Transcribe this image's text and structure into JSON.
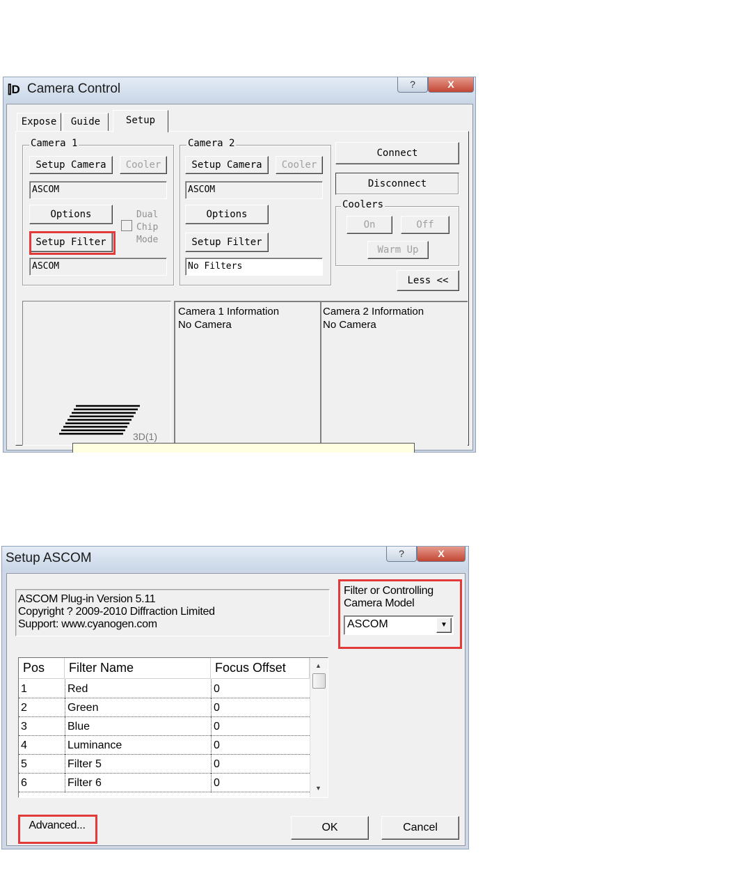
{
  "camera_control": {
    "title": "Camera Control",
    "help_glyph": "?",
    "close_glyph": "X",
    "tabs": [
      "Expose",
      "Guide",
      "Setup"
    ],
    "camera1": {
      "group_label": "Camera 1",
      "setup_camera": "Setup Camera",
      "cooler": "Cooler",
      "camera_model": "ASCOM",
      "options": "Options",
      "dual_chip_mode": [
        "Dual",
        "Chip",
        "Mode"
      ],
      "setup_filter": "Setup Filter",
      "filter_model": "ASCOM"
    },
    "camera2": {
      "group_label": "Camera 2",
      "setup_camera": "Setup Camera",
      "cooler": "Cooler",
      "camera_model": "ASCOM",
      "options": "Options",
      "setup_filter": "Setup Filter",
      "filter_model": "No Filters"
    },
    "connect": "Connect",
    "disconnect": "Disconnect",
    "coolers": {
      "group_label": "Coolers",
      "on": "On",
      "off": "Off",
      "warm_up": "Warm Up"
    },
    "less": "Less <<",
    "preview_logo_text": "3D(1)",
    "camera1_info": {
      "title": "Camera 1 Information",
      "status": "No Camera"
    },
    "camera2_info": {
      "title": "Camera 2 Information",
      "status": "No Camera"
    }
  },
  "setup_ascom": {
    "title": "Setup ASCOM",
    "help_glyph": "?",
    "close_glyph": "X",
    "plugin_info": [
      "ASCOM Plug-in Version 5.11",
      "Copyright ? 2009-2010 Diffraction Limited",
      "Support: www.cyanogen.com"
    ],
    "model_label": [
      "Filter or Controlling",
      "Camera Model"
    ],
    "model_value": "ASCOM",
    "table": {
      "columns": [
        "Pos",
        "Filter Name",
        "Focus Offset"
      ],
      "rows": [
        [
          "1",
          "Red",
          "0"
        ],
        [
          "2",
          "Green",
          "0"
        ],
        [
          "3",
          "Blue",
          "0"
        ],
        [
          "4",
          "Luminance",
          "0"
        ],
        [
          "5",
          "Filter 5",
          "0"
        ],
        [
          "6",
          "Filter 6",
          "0"
        ]
      ]
    },
    "advanced": "Advanced...",
    "ok": "OK",
    "cancel": "Cancel"
  }
}
